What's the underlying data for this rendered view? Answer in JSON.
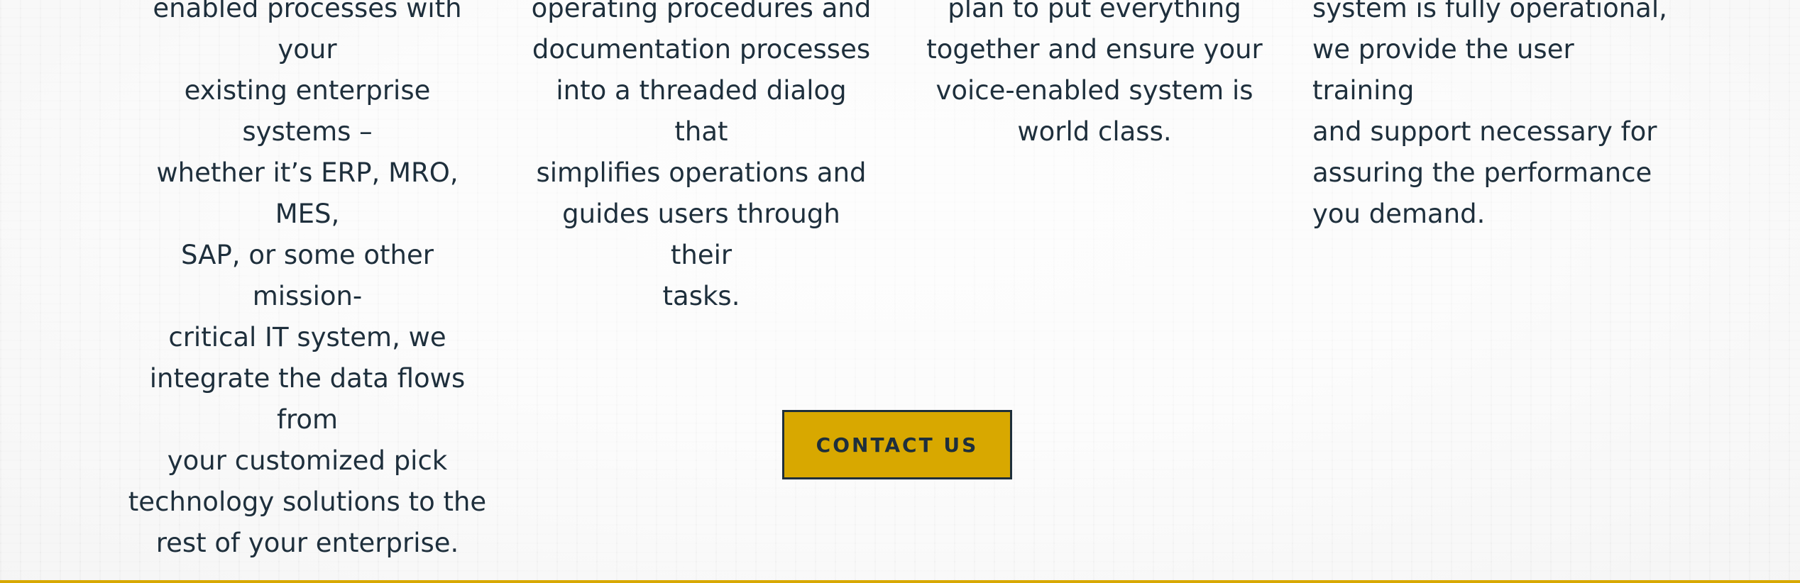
{
  "columns": [
    {
      "text": "enabled processes with your\nexisting enterprise systems –\nwhether it’s ERP, MRO, MES,\nSAP, or some other mission-\ncritical IT system, we\nintegrate the data flows from\nyour customized pick\ntechnology solutions to the\nrest of your enterprise."
    },
    {
      "text": "operating procedures and\ndocumentation processes\ninto a threaded dialog that\nsimplifies operations and\nguides users through their\ntasks."
    },
    {
      "text": "plan to put everything\ntogether and ensure your\nvoice-enabled system is\nworld class."
    },
    {
      "text": "system is fully operational,\nwe provide the user training\nand support necessary for\nassuring the performance\nyou demand."
    }
  ],
  "cta": {
    "label": "CONTACT US"
  },
  "colors": {
    "accent": "#d8a800",
    "text": "#1e2f3c",
    "background": "#f0f0f0"
  }
}
